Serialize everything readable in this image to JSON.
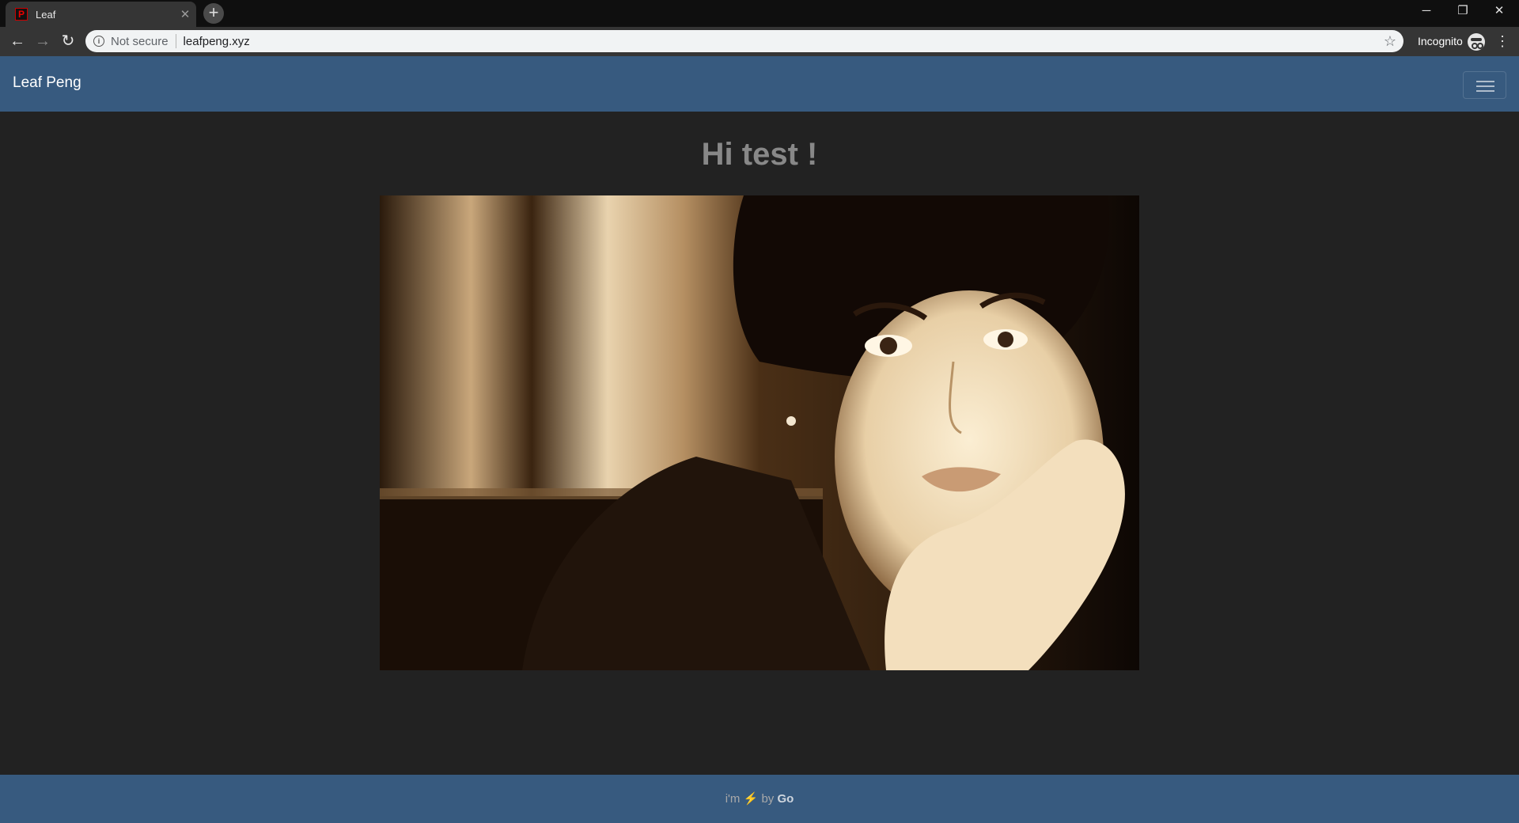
{
  "browser": {
    "tab_title": "Leaf",
    "favicon_letter": "P",
    "security_label": "Not secure",
    "url": "leafpeng.xyz",
    "profile_label": "Incognito"
  },
  "site": {
    "brand": "Leaf Peng",
    "greeting": "Hi test !",
    "footer": {
      "prefix": "i'm",
      "bolt": "⚡",
      "by": "by",
      "tech": "Go"
    }
  },
  "colors": {
    "navbar": "#375a7f",
    "page_bg": "#222222",
    "greeting_text": "#888888"
  }
}
